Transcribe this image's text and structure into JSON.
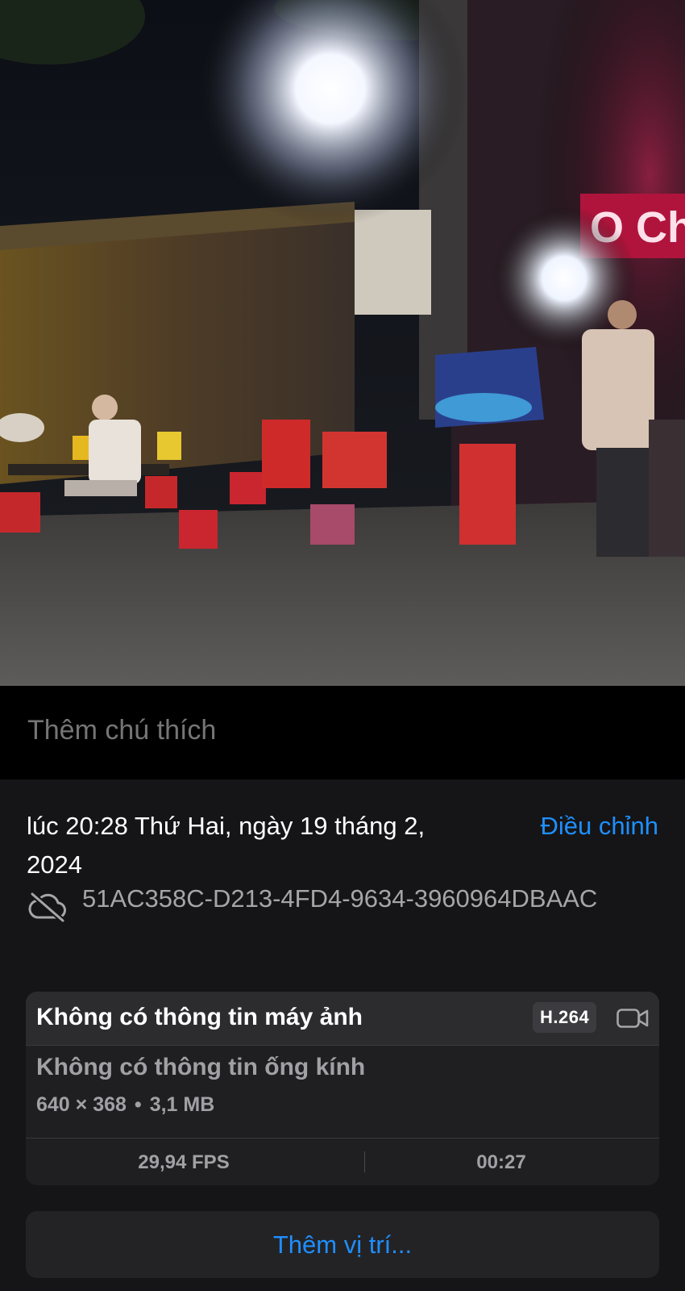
{
  "media": {
    "sign_text": "O Chi"
  },
  "caption": {
    "placeholder": "Thêm chú thích"
  },
  "info": {
    "date_text": "lúc 20:28 Thứ Hai, ngày 19 tháng 2, 2024",
    "adjust_label": "Điều chỉnh",
    "cloud_icon": "cloud-slash-icon",
    "file_id": "51AC358C-D213-4FD4-9634-3960964DBAAC"
  },
  "camera": {
    "title": "Không có thông tin máy ảnh",
    "codec": "H.264",
    "video_icon": "video-camera-icon",
    "lens": "Không có thông tin ống kính",
    "resolution": "640 × 368",
    "separator": "•",
    "size": "3,1 MB",
    "fps": "29,94 FPS",
    "duration": "00:27"
  },
  "location": {
    "label": "Thêm vị trí..."
  },
  "colors": {
    "accent": "#1f8fff",
    "sheet_background": "#151517",
    "card_background": "#1f1f22"
  }
}
